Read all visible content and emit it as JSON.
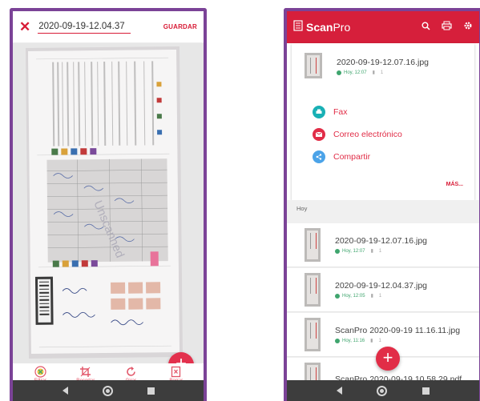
{
  "editor": {
    "title_value": "2020-09-19-12.04.37",
    "save_label": "GUARDAR",
    "fab_label": "+",
    "tools": [
      {
        "label": "Filtrar",
        "icon": "filter-icon"
      },
      {
        "label": "Recortar",
        "icon": "crop-icon"
      },
      {
        "label": "Girar",
        "icon": "rotate-icon"
      },
      {
        "label": "Borrar",
        "icon": "delete-icon"
      }
    ]
  },
  "app": {
    "title_bold": "Scan",
    "title_light": "Pro",
    "actions": [
      "search-icon",
      "printer-icon",
      "settings-icon"
    ],
    "brand_color": "#d61f3b",
    "share_card": {
      "file_name": "2020-09-19-12.07.16.jpg",
      "date": "Hoy, 12:07",
      "pages": "1",
      "options": [
        {
          "label": "Fax",
          "icon": "fax-icon",
          "color": "#19b0b5"
        },
        {
          "label": "Correo electrónico",
          "icon": "mail-icon",
          "color": "#e12d47"
        },
        {
          "label": "Compartir",
          "icon": "share-icon",
          "color": "#4ba3e8"
        }
      ],
      "more_label": "MÁS..."
    },
    "section_label": "Hoy",
    "files": [
      {
        "name": "2020-09-19-12.07.16.jpg",
        "date": "Hoy, 12:07",
        "pages": "1"
      },
      {
        "name": "2020-09-19-12.04.37.jpg",
        "date": "Hoy, 12:05",
        "pages": "1"
      },
      {
        "name": "ScanPro 2020-09-19 11.16.11.jpg",
        "date": "Hoy, 11:16",
        "pages": "1"
      },
      {
        "name": "ScanPro 2020-09-19 10.58.29.pdf",
        "date": "",
        "pages": ""
      }
    ],
    "fab_label": "+"
  },
  "navbar": {
    "buttons": [
      "back-icon",
      "home-icon",
      "recent-apps-icon"
    ]
  }
}
